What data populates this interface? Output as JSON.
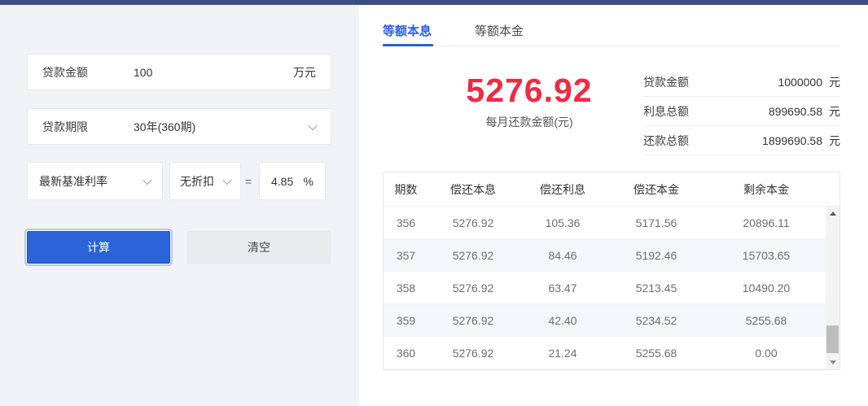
{
  "form": {
    "loan_amount": {
      "label": "贷款金额",
      "value": "100",
      "unit": "万元"
    },
    "loan_term": {
      "label": "贷款期限",
      "value": "30年(360期)"
    },
    "rate": {
      "base_option": "最新基准利率",
      "discount_option": "无折扣",
      "equals": "=",
      "value": "4.85",
      "unit": "%"
    },
    "calc_label": "计算",
    "clear_label": "清空"
  },
  "tabs": [
    {
      "label": "等额本息",
      "active": true
    },
    {
      "label": "等额本金",
      "active": false
    }
  ],
  "result": {
    "monthly_payment": "5276.92",
    "caption": "每月还款金额(元)"
  },
  "summary": [
    {
      "label": "贷款金额",
      "value": "1000000",
      "unit": "元"
    },
    {
      "label": "利息总额",
      "value": "899690.58",
      "unit": "元"
    },
    {
      "label": "还款总额",
      "value": "1899690.58",
      "unit": "元"
    }
  ],
  "table": {
    "headers": [
      "期数",
      "偿还本息",
      "偿还利息",
      "偿还本金",
      "剩余本金"
    ],
    "rows": [
      [
        "356",
        "5276.92",
        "105.36",
        "5171.56",
        "20896.11"
      ],
      [
        "357",
        "5276.92",
        "84.46",
        "5192.46",
        "15703.65"
      ],
      [
        "358",
        "5276.92",
        "63.47",
        "5213.45",
        "10490.20"
      ],
      [
        "359",
        "5276.92",
        "42.40",
        "5234.52",
        "5255.68"
      ],
      [
        "360",
        "5276.92",
        "21.24",
        "5255.68",
        "0.00"
      ]
    ]
  },
  "colors": {
    "topbar": "#3e4d80",
    "accent_blue": "#2a5fdd",
    "button_blue": "#2d63da",
    "highlight_red": "#ee2b44",
    "panel_gray": "#f1f2f5"
  }
}
